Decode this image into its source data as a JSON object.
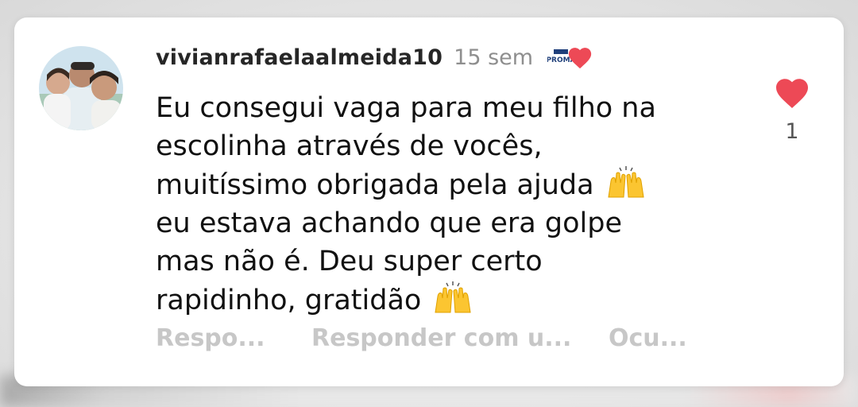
{
  "comment": {
    "username": "vivianrafaelaalmeida10",
    "time_ago": "15 sem",
    "badge_text": "PROMA",
    "lines": [
      "Eu consegui vaga para meu filho na",
      "escolinha através de vocês,",
      "muitíssimo obrigada pela ajuda",
      "eu estava achando que era golpe",
      "mas não é. Deu super certo",
      "rapidinho, gratidão"
    ],
    "emojis": [
      "raising-hands",
      "raising-hands"
    ],
    "like_count": "1",
    "liked": true,
    "actions": {
      "reply": "Respo...",
      "reply_with": "Responder com u...",
      "hide": "Ocu..."
    }
  },
  "colors": {
    "heart": "#ed4956",
    "username": "#262626",
    "muted": "#8e8e8e",
    "action": "#c7c7c7"
  }
}
